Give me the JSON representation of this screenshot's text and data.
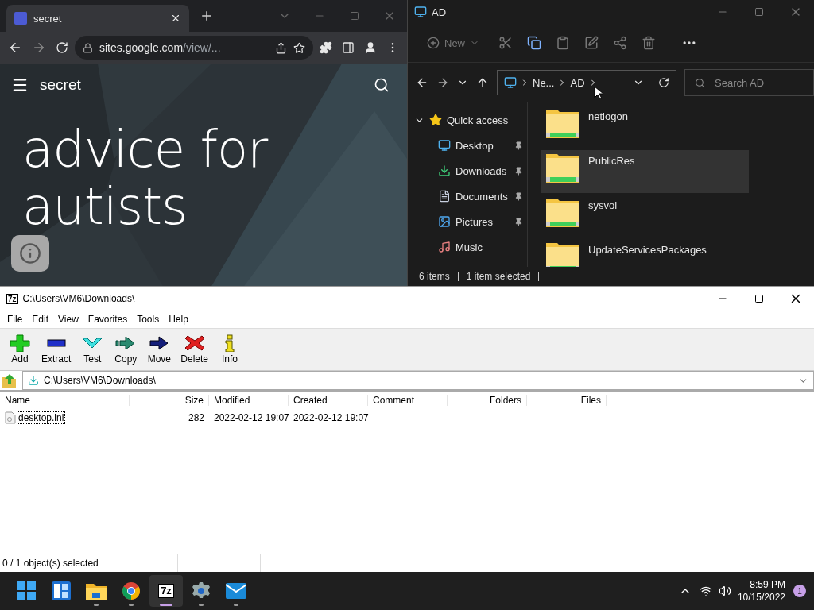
{
  "browser": {
    "tab": {
      "title": "secret",
      "selected": true
    },
    "url_host": "sites.google.com",
    "url_path": "/view/...",
    "site_title": "secret",
    "heading_lines": [
      "advice for",
      "autists"
    ]
  },
  "explorer": {
    "title": "AD",
    "new_label": "New",
    "breadcrumb": [
      "Ne...",
      "AD"
    ],
    "search_placeholder": "Search AD",
    "quick_access": {
      "label": "Quick access",
      "expanded": true
    },
    "nav": [
      {
        "label": "Desktop",
        "kind": "desktop",
        "pinned": true
      },
      {
        "label": "Downloads",
        "kind": "downloads",
        "pinned": true
      },
      {
        "label": "Documents",
        "kind": "documents",
        "pinned": true
      },
      {
        "label": "Pictures",
        "kind": "pictures",
        "pinned": true
      },
      {
        "label": "Music",
        "kind": "music",
        "pinned": false
      }
    ],
    "folders": [
      {
        "name": "netlogon",
        "selected": false
      },
      {
        "name": "PublicRes",
        "selected": true
      },
      {
        "name": "sysvol",
        "selected": false
      },
      {
        "name": "UpdateServicesPackages",
        "selected": false
      }
    ],
    "status": [
      "6 items",
      "1 item selected"
    ]
  },
  "sevenzip": {
    "logo": "7z",
    "title": "C:\\Users\\VM6\\Downloads\\",
    "menu": [
      "File",
      "Edit",
      "View",
      "Favorites",
      "Tools",
      "Help"
    ],
    "tools": [
      {
        "label": "Add",
        "kind": "add"
      },
      {
        "label": "Extract",
        "kind": "extract"
      },
      {
        "label": "Test",
        "kind": "test"
      },
      {
        "label": "Copy",
        "kind": "copy"
      },
      {
        "label": "Move",
        "kind": "move"
      },
      {
        "label": "Delete",
        "kind": "delete"
      },
      {
        "label": "Info",
        "kind": "info"
      }
    ],
    "path": "C:\\Users\\VM6\\Downloads\\",
    "columns": [
      {
        "label": "Name",
        "right_aligned": false
      },
      {
        "label": "Size",
        "right_aligned": true
      },
      {
        "label": "Modified",
        "right_aligned": false
      },
      {
        "label": "Created",
        "right_aligned": false
      },
      {
        "label": "Comment",
        "right_aligned": false
      },
      {
        "label": "Folders",
        "right_aligned": true
      },
      {
        "label": "Files",
        "right_aligned": true
      }
    ],
    "rows": [
      {
        "cells": [
          "desktop.ini",
          "282",
          "2022-02-12 19:07",
          "2022-02-12 19:07"
        ],
        "selected": true
      }
    ],
    "status": "0 / 1 object(s) selected"
  },
  "taskbar": {
    "apps": [
      {
        "kind": "start",
        "running": false,
        "active": false
      },
      {
        "kind": "widgets",
        "running": false,
        "active": false
      },
      {
        "kind": "explorer",
        "running": true,
        "active": false
      },
      {
        "kind": "chrome",
        "running": true,
        "active": false
      },
      {
        "kind": "sevenzip",
        "label": "7z",
        "running": true,
        "active": true
      },
      {
        "kind": "settings",
        "running": true,
        "active": false
      },
      {
        "kind": "mail",
        "running": true,
        "active": false
      }
    ],
    "time": "8:59 PM",
    "date": "10/15/2022",
    "notification_count": "1"
  }
}
